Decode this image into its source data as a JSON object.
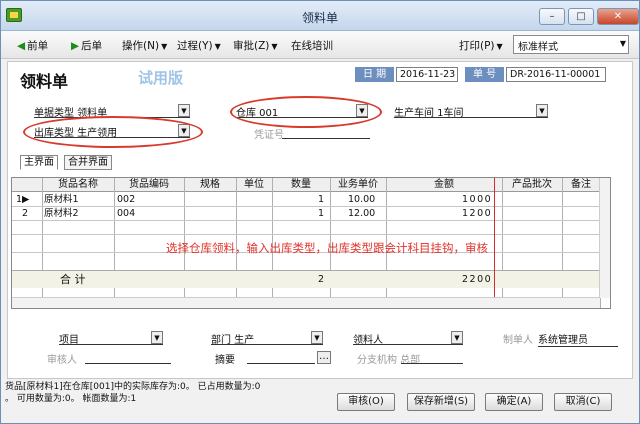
{
  "window": {
    "title": "领料单",
    "min": "–",
    "max": "□",
    "close": "✕"
  },
  "toolbar": {
    "prev": "前单",
    "next": "后单",
    "operate": "操作(N)",
    "process": "过程(Y)",
    "approve": "审批(Z)",
    "training": "在线培训",
    "print": "打印(P)",
    "style_value": "标准样式"
  },
  "form": {
    "title": "领料单",
    "trial": "试用版",
    "date_label": "日  期",
    "date_value": "2016-11-23",
    "docno_label": "单  号",
    "docno_value": "DR-2016-11-00001",
    "doctype": "单据类型 领料单",
    "warehouse": "仓库 001",
    "workshop": "生产车间 1车间",
    "outtype": "出库类型 生产领用",
    "voucher": "凭证号"
  },
  "tabs": [
    "主界面",
    "合并界面"
  ],
  "table": {
    "headers": [
      "货品名称",
      "货品编码",
      "规格",
      "单位",
      "数量",
      "业务单价",
      "金额",
      "产品批次",
      "备注"
    ],
    "rows": [
      {
        "idx": "1",
        "name": "原材料1",
        "code": "002",
        "qty": "1",
        "price": "10.00",
        "amount": "1000"
      },
      {
        "idx": "2",
        "name": "原材料2",
        "code": "004",
        "qty": "1",
        "price": "12.00",
        "amount": "1200"
      }
    ],
    "total_label": "合    计",
    "total_qty": "2",
    "total_amount": "2200"
  },
  "annotation": "选择仓库领料，输入出库类型，出库类型跟会计科目挂钩，审核",
  "footer": {
    "item": "项目",
    "dept": "部门 生产",
    "picker": "领料人",
    "creator_label": "制单人",
    "creator_value": "系统管理员",
    "reviewer": "审核人",
    "summary": "摘要",
    "branch": "分支机构 总部"
  },
  "status": {
    "line1": "货品[原材料1]在仓库[001]中的实际库存为:0。 已占用数量为:0",
    "line2": "。 可用数量为:0。 帐面数量为:1"
  },
  "buttons": {
    "audit": "审核(O)",
    "save_new": "保存新增(S)",
    "ok": "确定(A)",
    "cancel": "取消(C)"
  }
}
